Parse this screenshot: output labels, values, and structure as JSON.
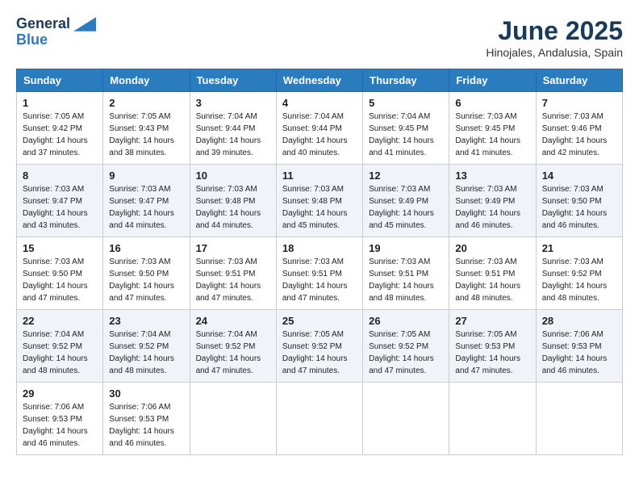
{
  "header": {
    "logo_line1": "General",
    "logo_line2": "Blue",
    "month_title": "June 2025",
    "location": "Hinojales, Andalusia, Spain"
  },
  "weekdays": [
    "Sunday",
    "Monday",
    "Tuesday",
    "Wednesday",
    "Thursday",
    "Friday",
    "Saturday"
  ],
  "weeks": [
    [
      {
        "day": "1",
        "sunrise": "7:05 AM",
        "sunset": "9:42 PM",
        "daylight": "14 hours and 37 minutes."
      },
      {
        "day": "2",
        "sunrise": "7:05 AM",
        "sunset": "9:43 PM",
        "daylight": "14 hours and 38 minutes."
      },
      {
        "day": "3",
        "sunrise": "7:04 AM",
        "sunset": "9:44 PM",
        "daylight": "14 hours and 39 minutes."
      },
      {
        "day": "4",
        "sunrise": "7:04 AM",
        "sunset": "9:44 PM",
        "daylight": "14 hours and 40 minutes."
      },
      {
        "day": "5",
        "sunrise": "7:04 AM",
        "sunset": "9:45 PM",
        "daylight": "14 hours and 41 minutes."
      },
      {
        "day": "6",
        "sunrise": "7:03 AM",
        "sunset": "9:45 PM",
        "daylight": "14 hours and 41 minutes."
      },
      {
        "day": "7",
        "sunrise": "7:03 AM",
        "sunset": "9:46 PM",
        "daylight": "14 hours and 42 minutes."
      }
    ],
    [
      {
        "day": "8",
        "sunrise": "7:03 AM",
        "sunset": "9:47 PM",
        "daylight": "14 hours and 43 minutes."
      },
      {
        "day": "9",
        "sunrise": "7:03 AM",
        "sunset": "9:47 PM",
        "daylight": "14 hours and 44 minutes."
      },
      {
        "day": "10",
        "sunrise": "7:03 AM",
        "sunset": "9:48 PM",
        "daylight": "14 hours and 44 minutes."
      },
      {
        "day": "11",
        "sunrise": "7:03 AM",
        "sunset": "9:48 PM",
        "daylight": "14 hours and 45 minutes."
      },
      {
        "day": "12",
        "sunrise": "7:03 AM",
        "sunset": "9:49 PM",
        "daylight": "14 hours and 45 minutes."
      },
      {
        "day": "13",
        "sunrise": "7:03 AM",
        "sunset": "9:49 PM",
        "daylight": "14 hours and 46 minutes."
      },
      {
        "day": "14",
        "sunrise": "7:03 AM",
        "sunset": "9:50 PM",
        "daylight": "14 hours and 46 minutes."
      }
    ],
    [
      {
        "day": "15",
        "sunrise": "7:03 AM",
        "sunset": "9:50 PM",
        "daylight": "14 hours and 47 minutes."
      },
      {
        "day": "16",
        "sunrise": "7:03 AM",
        "sunset": "9:50 PM",
        "daylight": "14 hours and 47 minutes."
      },
      {
        "day": "17",
        "sunrise": "7:03 AM",
        "sunset": "9:51 PM",
        "daylight": "14 hours and 47 minutes."
      },
      {
        "day": "18",
        "sunrise": "7:03 AM",
        "sunset": "9:51 PM",
        "daylight": "14 hours and 47 minutes."
      },
      {
        "day": "19",
        "sunrise": "7:03 AM",
        "sunset": "9:51 PM",
        "daylight": "14 hours and 48 minutes."
      },
      {
        "day": "20",
        "sunrise": "7:03 AM",
        "sunset": "9:51 PM",
        "daylight": "14 hours and 48 minutes."
      },
      {
        "day": "21",
        "sunrise": "7:03 AM",
        "sunset": "9:52 PM",
        "daylight": "14 hours and 48 minutes."
      }
    ],
    [
      {
        "day": "22",
        "sunrise": "7:04 AM",
        "sunset": "9:52 PM",
        "daylight": "14 hours and 48 minutes."
      },
      {
        "day": "23",
        "sunrise": "7:04 AM",
        "sunset": "9:52 PM",
        "daylight": "14 hours and 48 minutes."
      },
      {
        "day": "24",
        "sunrise": "7:04 AM",
        "sunset": "9:52 PM",
        "daylight": "14 hours and 47 minutes."
      },
      {
        "day": "25",
        "sunrise": "7:05 AM",
        "sunset": "9:52 PM",
        "daylight": "14 hours and 47 minutes."
      },
      {
        "day": "26",
        "sunrise": "7:05 AM",
        "sunset": "9:52 PM",
        "daylight": "14 hours and 47 minutes."
      },
      {
        "day": "27",
        "sunrise": "7:05 AM",
        "sunset": "9:53 PM",
        "daylight": "14 hours and 47 minutes."
      },
      {
        "day": "28",
        "sunrise": "7:06 AM",
        "sunset": "9:53 PM",
        "daylight": "14 hours and 46 minutes."
      }
    ],
    [
      {
        "day": "29",
        "sunrise": "7:06 AM",
        "sunset": "9:53 PM",
        "daylight": "14 hours and 46 minutes."
      },
      {
        "day": "30",
        "sunrise": "7:06 AM",
        "sunset": "9:53 PM",
        "daylight": "14 hours and 46 minutes."
      },
      null,
      null,
      null,
      null,
      null
    ]
  ],
  "labels": {
    "sunrise": "Sunrise:",
    "sunset": "Sunset:",
    "daylight": "Daylight:"
  }
}
